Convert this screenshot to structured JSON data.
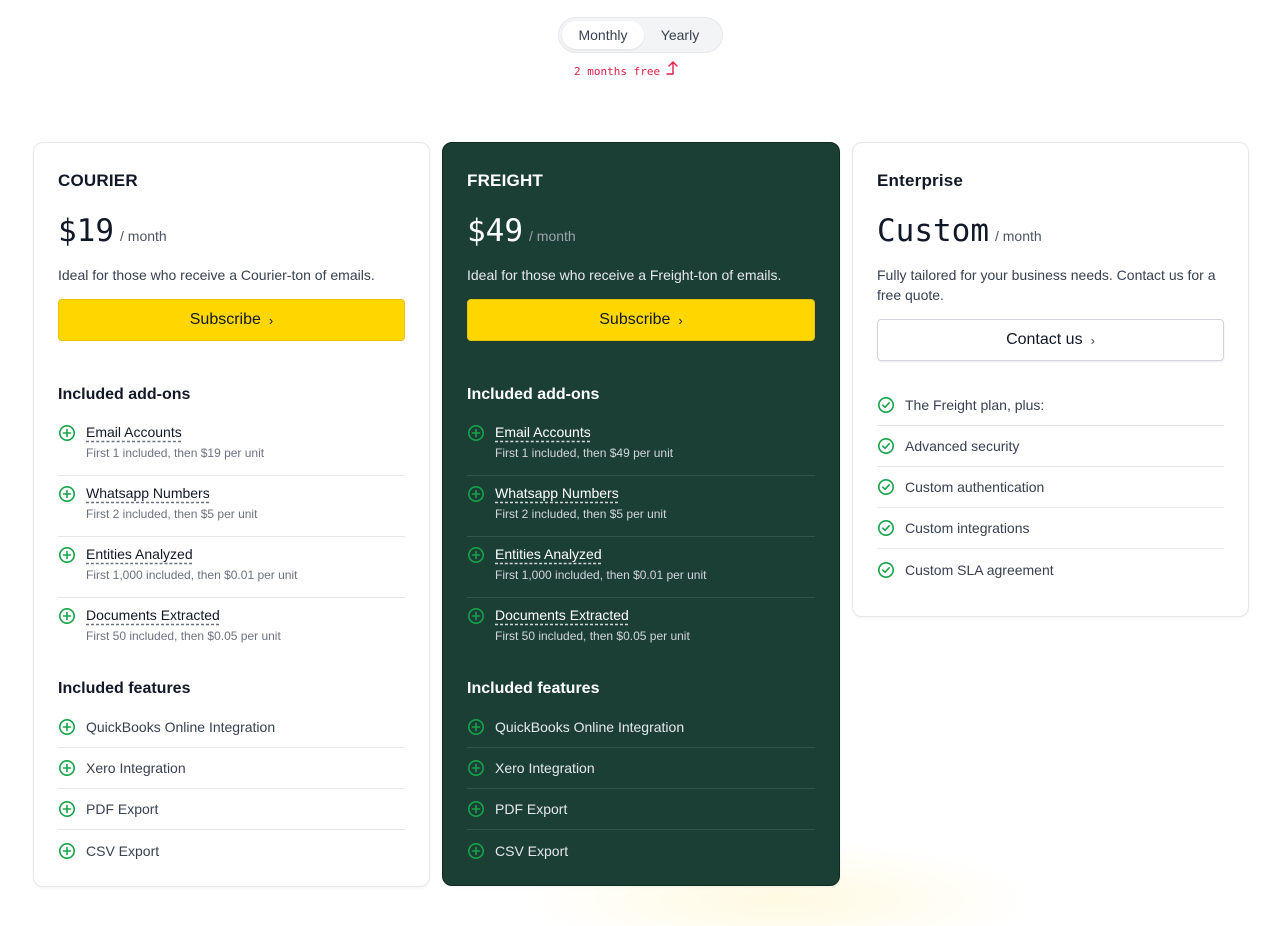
{
  "toggle": {
    "monthly": "Monthly",
    "yearly": "Yearly",
    "promo": "2 months free"
  },
  "colors": {
    "accent": "#ffd600",
    "dark_card": "#1c3f35",
    "icon_green": "#16a34a",
    "promo": "#e11d48"
  },
  "plans": [
    {
      "name": "COURIER",
      "price": "$19",
      "period": "/ month",
      "description": "Ideal for those who receive a Courier-ton of emails.",
      "cta": "Subscribe",
      "addons_title": "Included add-ons",
      "addons": [
        {
          "name": "Email Accounts",
          "detail": "First 1 included, then $19 per unit"
        },
        {
          "name": "Whatsapp Numbers",
          "detail": "First 2 included, then $5 per unit"
        },
        {
          "name": "Entities Analyzed",
          "detail": "First 1,000 included, then $0.01 per unit"
        },
        {
          "name": "Documents Extracted",
          "detail": "First 50 included, then $0.05 per unit"
        }
      ],
      "features_title": "Included features",
      "features": [
        "QuickBooks Online Integration",
        "Xero Integration",
        "PDF Export",
        "CSV Export"
      ]
    },
    {
      "name": "FREIGHT",
      "price": "$49",
      "period": "/ month",
      "description": "Ideal for those who receive a Freight-ton of emails.",
      "cta": "Subscribe",
      "addons_title": "Included add-ons",
      "addons": [
        {
          "name": "Email Accounts",
          "detail": "First 1 included, then $49 per unit"
        },
        {
          "name": "Whatsapp Numbers",
          "detail": "First 2 included, then $5 per unit"
        },
        {
          "name": "Entities Analyzed",
          "detail": "First 1,000 included, then $0.01 per unit"
        },
        {
          "name": "Documents Extracted",
          "detail": "First 50 included, then $0.05 per unit"
        }
      ],
      "features_title": "Included features",
      "features": [
        "QuickBooks Online Integration",
        "Xero Integration",
        "PDF Export",
        "CSV Export"
      ]
    },
    {
      "name": "Enterprise",
      "price": "Custom",
      "period": "/ month",
      "description": "Fully tailored for your business needs. Contact us for a free quote.",
      "cta": "Contact us",
      "features": [
        "The Freight plan, plus:",
        "Advanced security",
        "Custom authentication",
        "Custom integrations",
        "Custom SLA agreement"
      ]
    }
  ]
}
